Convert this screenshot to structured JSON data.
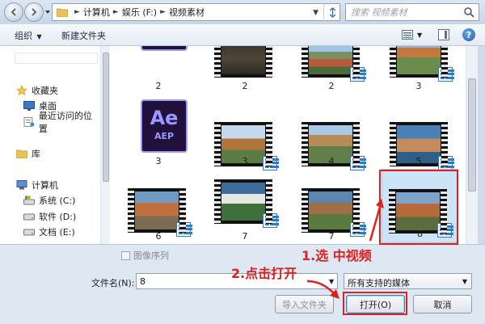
{
  "address_bar": {
    "crumbs": [
      "计算机",
      "娱乐 (F:)",
      "视频素材"
    ],
    "search_placeholder": "搜索 视频素材"
  },
  "toolbar": {
    "organize_label": "组织",
    "new_folder_label": "新建文件夹",
    "help_label": "?"
  },
  "nav": {
    "items": [
      {
        "label": "收藏夹",
        "icon": "star-icon"
      },
      {
        "label": "桌面",
        "icon": "desktop-icon"
      },
      {
        "label": "最近访问的位置",
        "icon": "recent-places-icon"
      },
      {
        "label": "库",
        "icon": "library-icon"
      },
      {
        "label": "计算机",
        "icon": "computer-icon"
      },
      {
        "label": "系统 (C:)",
        "icon": "system-drive-icon"
      },
      {
        "label": "软件 (D:)",
        "icon": "drive-icon"
      },
      {
        "label": "文档 (E:)",
        "icon": "drive-icon"
      }
    ]
  },
  "files": [
    {
      "name": "2",
      "type": "ae"
    },
    {
      "name": "2",
      "type": "video"
    },
    {
      "name": "2",
      "type": "video"
    },
    {
      "name": "3",
      "type": "video"
    },
    {
      "name": "3",
      "type": "ae"
    },
    {
      "name": "3",
      "type": "video"
    },
    {
      "name": "4",
      "type": "video"
    },
    {
      "name": "5",
      "type": "video"
    },
    {
      "name": "6",
      "type": "video"
    },
    {
      "name": "7",
      "type": "video"
    },
    {
      "name": "7",
      "type": "video"
    },
    {
      "name": "8",
      "type": "video",
      "selected": true
    }
  ],
  "ae_icon": {
    "big": "Ae",
    "small": "AEP"
  },
  "bottom": {
    "image_sequence_label": "图像序列",
    "filename_label": "文件名(N):",
    "filename_value": "8",
    "filetype_value": "所有支持的媒体",
    "import_folder_label": "导入文件夹",
    "open_label": "打开(O)",
    "cancel_label": "取消"
  },
  "annotations": {
    "step1": "1.选 中视频",
    "step2": "2.点击打开",
    "color": "#e02020"
  }
}
